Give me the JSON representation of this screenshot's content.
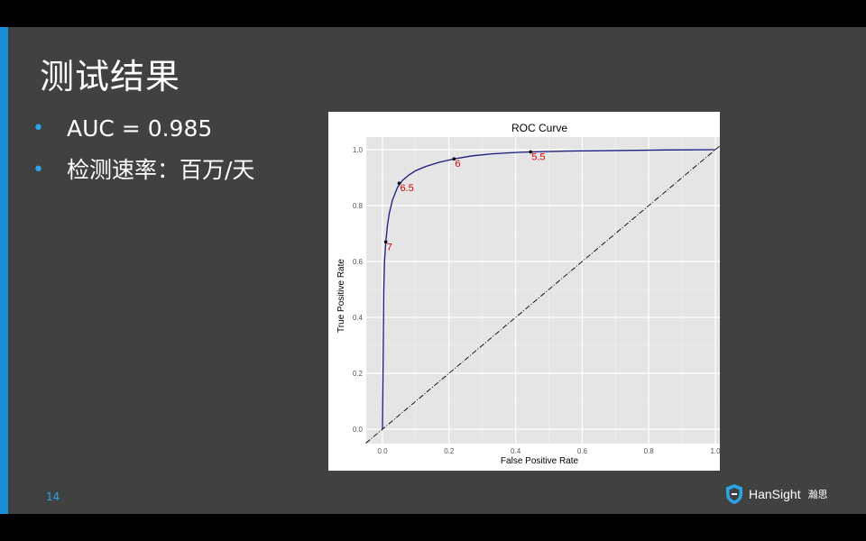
{
  "slide": {
    "title": "测试结果",
    "bullets": [
      {
        "symbol": "•",
        "text": "AUC = 0.985"
      },
      {
        "symbol": "•",
        "text": "检测速率：百万/天"
      }
    ],
    "page_number": "14",
    "logo": {
      "name": "HanSight",
      "subtitle": "瀚思",
      "icon": "shield-icon"
    },
    "colors": {
      "background": "#414141",
      "accent": "#1a8fd8",
      "bullet": "#2aa6e6",
      "text": "#ffffff"
    }
  },
  "chart_data": {
    "type": "line",
    "title": "ROC Curve",
    "xlabel": "False Positive Rate",
    "ylabel": "True Positive Rate",
    "xlim": [
      0,
      1
    ],
    "ylim": [
      0,
      1
    ],
    "x_ticks": [
      "0.0",
      "0.2",
      "0.4",
      "0.6",
      "0.8",
      "1.0"
    ],
    "y_ticks": [
      "0.0",
      "0.2",
      "0.4",
      "0.6",
      "0.8",
      "1.0"
    ],
    "grid": true,
    "series": [
      {
        "color": "#1a1a80",
        "x": [
          0.0,
          0.002,
          0.004,
          0.006,
          0.01,
          0.015,
          0.02,
          0.03,
          0.045,
          0.06,
          0.08,
          0.1,
          0.13,
          0.17,
          0.215,
          0.27,
          0.33,
          0.4,
          0.445,
          0.55,
          0.7,
          0.85,
          1.0
        ],
        "y": [
          0.0,
          0.25,
          0.5,
          0.6,
          0.67,
          0.73,
          0.77,
          0.82,
          0.865,
          0.89,
          0.91,
          0.925,
          0.94,
          0.955,
          0.967,
          0.978,
          0.985,
          0.99,
          0.992,
          0.995,
          0.997,
          0.999,
          1.0
        ]
      },
      {
        "color": "#000000",
        "style": "dashdot",
        "x": [
          0,
          1
        ],
        "y": [
          0,
          1
        ]
      }
    ],
    "thresholds": [
      {
        "label": "7",
        "x": 0.01,
        "y": 0.67
      },
      {
        "label": "6.5",
        "x": 0.05,
        "y": 0.88
      },
      {
        "label": "6",
        "x": 0.215,
        "y": 0.967
      },
      {
        "label": "5.5",
        "x": 0.445,
        "y": 0.992
      }
    ],
    "colors": {
      "panel": "#e5e5e5",
      "grid": "#ffffff",
      "threshold_label": "#e00000"
    }
  }
}
